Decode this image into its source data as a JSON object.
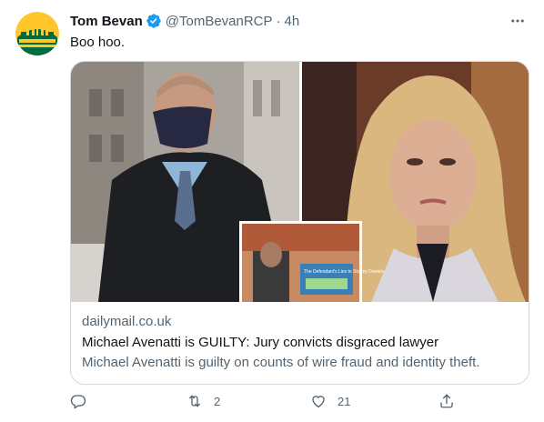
{
  "tweet": {
    "display_name": "Tom Bevan",
    "handle": "@TomBevanRCP",
    "separator": "·",
    "timestamp": "4h",
    "text": "Boo hoo.",
    "verified": true
  },
  "card": {
    "domain": "dailymail.co.uk",
    "title": "Michael Avenatti is GUILTY: Jury convicts disgraced lawyer",
    "description": "Michael Avenatti is guilty on counts of wire fraud and identity theft.",
    "inset_sign_text": "The Defendant's Lies to Stormy Daniels"
  },
  "actions": {
    "reply_count": "",
    "retweet_count": "2",
    "like_count": "21"
  },
  "icons": {
    "avatar": "seattle-supersonics-logo",
    "verified": "verified-badge-icon",
    "more": "more-dots-icon",
    "reply": "reply-icon",
    "retweet": "retweet-icon",
    "like": "heart-icon",
    "share": "share-icon"
  },
  "colors": {
    "text_primary": "#0f1419",
    "text_secondary": "#536471",
    "verified_blue": "#1d9bf0",
    "card_border": "#cfd9de",
    "avatar_green": "#006b3f",
    "avatar_yellow": "#ffc72c"
  }
}
